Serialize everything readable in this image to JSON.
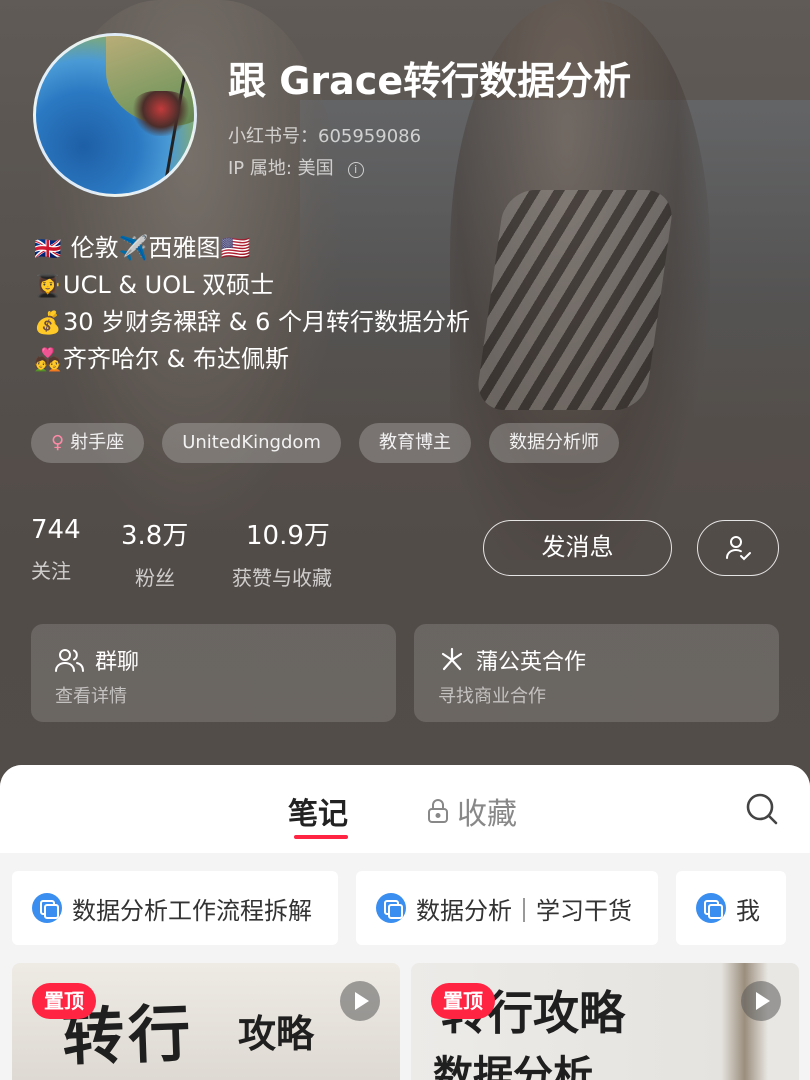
{
  "profile": {
    "name": "跟 Grace转行数据分析",
    "id_line": "小红书号：605959086",
    "ip_line": "IP 属地: 美国",
    "bio": [
      {
        "emoji": "🇬🇧",
        "text": "伦敦✈️西雅图🇺🇸"
      },
      {
        "emoji": "👩‍🎓",
        "text": "UCL & UOL 双硕士"
      },
      {
        "emoji": "💰",
        "text": "30 岁财务裸辞 & 6 个月转行数据分析"
      },
      {
        "emoji": "💑",
        "text": "齐齐哈尔 & 布达佩斯"
      }
    ],
    "tags": [
      {
        "icon": "♀",
        "label": "射手座"
      },
      {
        "label": "UnitedKingdom"
      },
      {
        "label": "教育博主"
      },
      {
        "label": "数据分析师"
      }
    ],
    "stats": [
      {
        "value": "744",
        "label": "关注"
      },
      {
        "value": "3.8万",
        "label": "粉丝"
      },
      {
        "value": "10.9万",
        "label": "获赞与收藏"
      }
    ],
    "message_button": "发消息",
    "follow_icon": "user-check-icon"
  },
  "cards": [
    {
      "icon": "group-icon",
      "title": "群聊",
      "subtitle": "查看详情"
    },
    {
      "icon": "sparkle-icon",
      "title": "蒲公英合作",
      "subtitle": "寻找商业合作"
    }
  ],
  "tabs": {
    "notes": "笔记",
    "favorites": "收藏",
    "favorites_icon": "lock-icon",
    "search_icon": "search-icon"
  },
  "collections": [
    {
      "label": "数据分析工作流程拆解"
    },
    {
      "label": "数据分析｜学习干货"
    },
    {
      "label": "我"
    }
  ],
  "posts": [
    {
      "pin": "置顶",
      "title_main": "转行",
      "title_sub": "攻略"
    },
    {
      "pin": "置顶",
      "title_main": "转行攻略",
      "title_sub": "数据分析"
    }
  ],
  "colors": {
    "accent": "#ff2442",
    "collection_icon": "#3a8ef0"
  }
}
